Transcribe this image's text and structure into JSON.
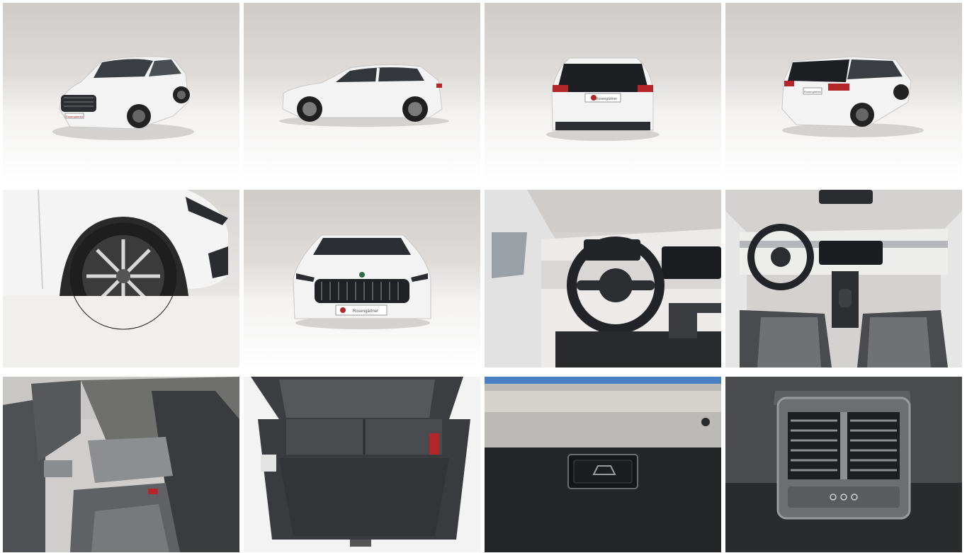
{
  "gallery": {
    "photos": [
      {
        "id": "front-three-quarter",
        "plate_text": "Rosengärtner"
      },
      {
        "id": "side-profile"
      },
      {
        "id": "rear-view",
        "plate_text": "Rosengärtner"
      },
      {
        "id": "rear-three-quarter",
        "plate_text": "Rosengärtner"
      },
      {
        "id": "front-wheel-detail"
      },
      {
        "id": "front-view",
        "plate_text": "Rosengärtner"
      },
      {
        "id": "dashboard-driver-view"
      },
      {
        "id": "dashboard-center-view"
      },
      {
        "id": "rear-seats"
      },
      {
        "id": "trunk-open"
      },
      {
        "id": "tailgate-button"
      },
      {
        "id": "rear-air-vents"
      }
    ]
  },
  "colors": {
    "car_body": "#f3f3f3",
    "backdrop": "#d9d6d3",
    "interior_dark": "#2a2b2d",
    "accent_red": "#b3262a"
  }
}
